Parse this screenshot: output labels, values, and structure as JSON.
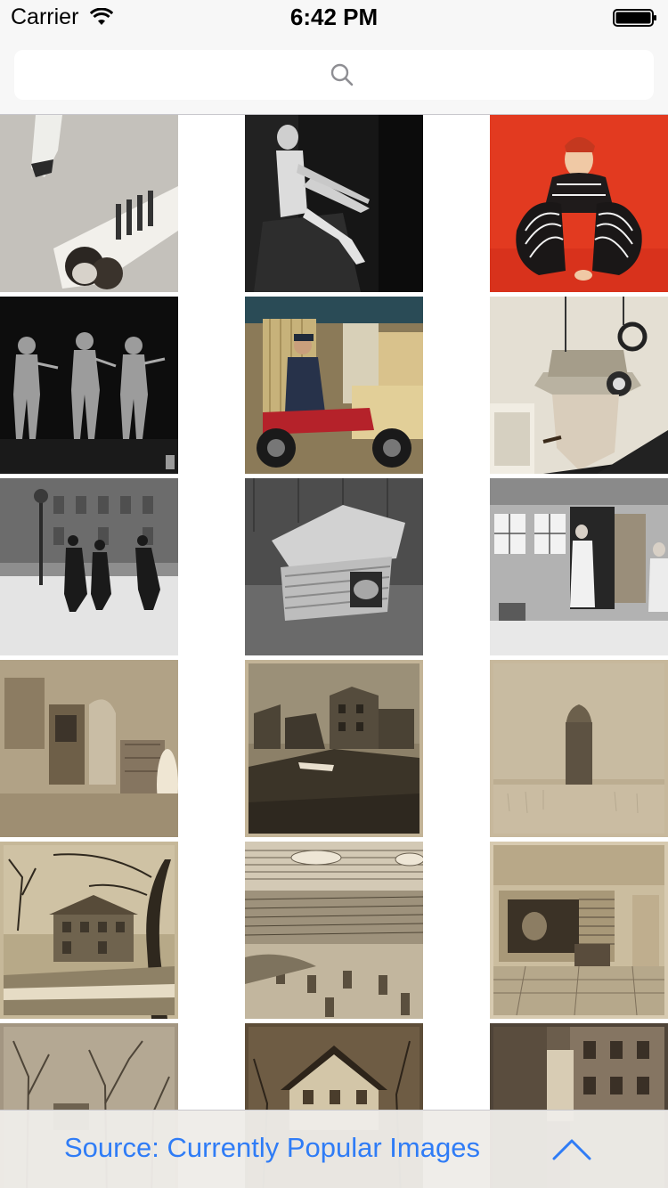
{
  "status_bar": {
    "carrier": "Carrier",
    "time": "6:42 PM"
  },
  "search": {
    "value": "",
    "placeholder": ""
  },
  "grid": {
    "tiles": [
      {
        "name": "photo-beach-women",
        "icon": "photo"
      },
      {
        "name": "photo-seated-figure",
        "icon": "photo"
      },
      {
        "name": "photo-striped-costume",
        "icon": "photo"
      },
      {
        "name": "photo-dancers",
        "icon": "photo"
      },
      {
        "name": "photo-motorcycle-rider",
        "icon": "photo"
      },
      {
        "name": "photo-hat-contraption",
        "icon": "photo"
      },
      {
        "name": "photo-snowy-street",
        "icon": "photo"
      },
      {
        "name": "photo-cat-house",
        "icon": "photo"
      },
      {
        "name": "photo-house-doorway",
        "icon": "photo"
      },
      {
        "name": "photo-interior-room",
        "icon": "photo"
      },
      {
        "name": "photo-city-buildings",
        "icon": "photo"
      },
      {
        "name": "photo-stone-tower",
        "icon": "photo"
      },
      {
        "name": "photo-tree-house",
        "icon": "photo"
      },
      {
        "name": "photo-engraved-landscape",
        "icon": "photo"
      },
      {
        "name": "photo-fireplace-sketch",
        "icon": "photo"
      },
      {
        "name": "photo-bare-trees",
        "icon": "photo"
      },
      {
        "name": "photo-victorian-house",
        "icon": "photo"
      },
      {
        "name": "photo-alley-buildings",
        "icon": "photo"
      }
    ]
  },
  "bottom_bar": {
    "source_label": "Source: Currently Popular Images"
  },
  "colors": {
    "accent": "#2f7cf6",
    "bar_bg": "#f7f7f7"
  }
}
